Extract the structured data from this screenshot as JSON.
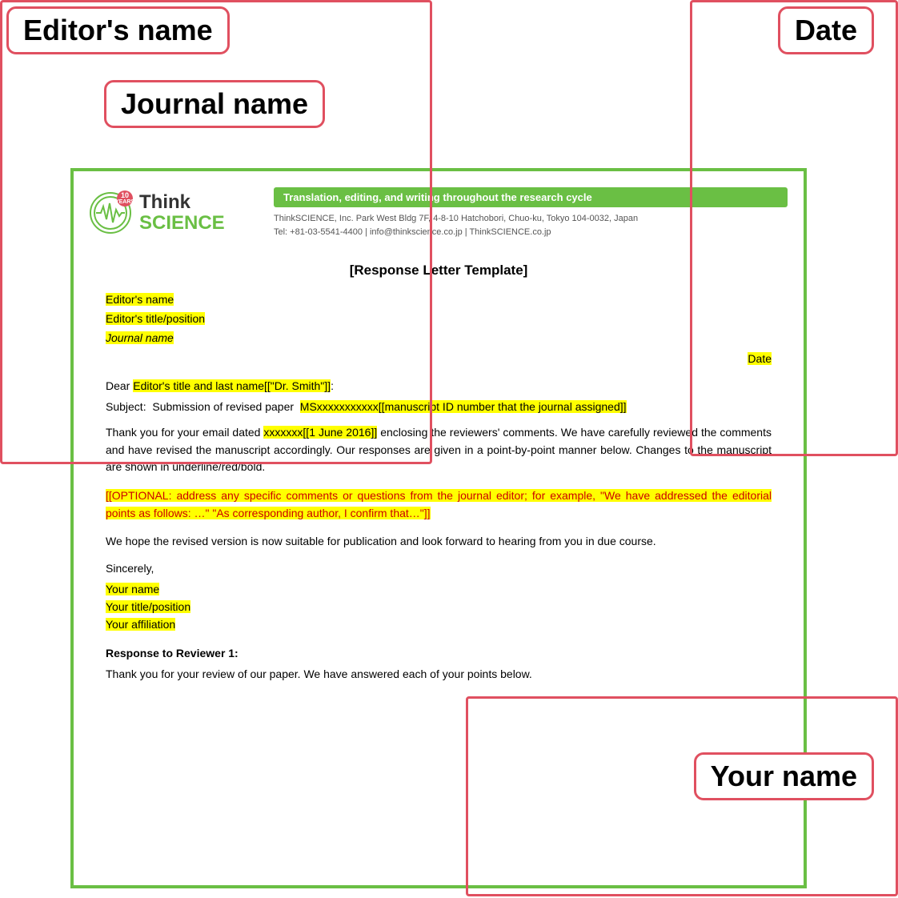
{
  "annotations": {
    "editors_name_label": "Editor's name",
    "date_label": "Date",
    "journal_name_label": "Journal name",
    "your_name_label": "Your name"
  },
  "logo": {
    "badge_line1": "10",
    "badge_line2": "YEARS",
    "name_line1": "Think",
    "name_line2": "SCIENCE"
  },
  "header": {
    "tagline": "Translation, editing, and writing throughout the research cycle",
    "contact_line1": "ThinkSCIENCE, Inc.  Park West Bldg 7F, 4-8-10 Hatchobori, Chuo-ku, Tokyo 104-0032, Japan",
    "contact_line2": "Tel: +81-03-5541-4400 | info@thinkscience.co.jp | ThinkSCIENCE.co.jp"
  },
  "document": {
    "title": "[Response Letter Template]",
    "field_editors_name": "Editor's name",
    "field_editors_title": "Editor's title/position",
    "field_journal_name": "Journal name",
    "field_date": "Date",
    "dear_line": "Dear Editor's title and last name[[\"Dr. Smith\"]]:",
    "subject_prefix": "Subject:  Submission of revised paper  ",
    "subject_highlight": "MSxxxxxxxxxxx[[manuscript ID number that the journal assigned]]",
    "body1_pre": "Thank you for your email dated ",
    "body1_highlight": "xxxxxxx[[1 June 2016]]",
    "body1_post": " enclosing the reviewers' comments. We have carefully reviewed the comments and have revised the manuscript accordingly. Our responses are given in a point-by-point manner below. Changes to the manuscript are shown in underline/red/bold.",
    "optional_text": "[[OPTIONAL: address any specific comments or questions from the journal editor; for example, \"We have addressed the editorial points as follows: …\" \"As corresponding author, I confirm that…\"]]",
    "body2": "We hope the revised version is now suitable for publication and look forward to hearing from you in due course.",
    "sincerely": "Sincerely,",
    "your_name": "Your name",
    "your_title": "Your title/position",
    "your_affiliation": "Your affiliation",
    "reviewer_title": "Response to Reviewer 1:",
    "reviewer_body": "Thank you for your review of our paper. We have answered each of your points below."
  }
}
